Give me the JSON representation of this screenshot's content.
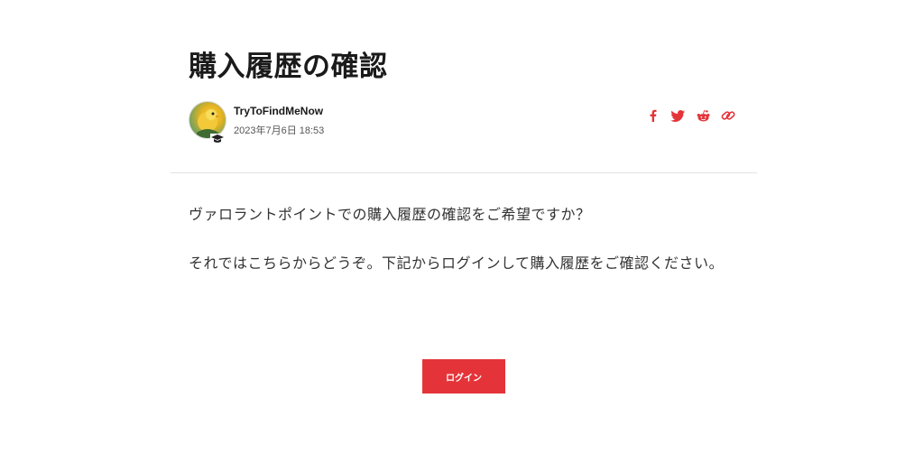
{
  "article": {
    "title": "購入履歴の確認",
    "author": {
      "name": "TryToFindMeNow",
      "date": "2023年7月6日 18:53"
    },
    "share": {
      "color": "#e4343a",
      "icons": [
        "facebook-icon",
        "twitter-icon",
        "reddit-icon",
        "link-icon"
      ]
    },
    "paragraphs": [
      "ヴァロラントポイントでの購入履歴の確認をご希望ですか？",
      "それではこちらからどうぞ。下記からログインして購入履歴をご確認ください。"
    ],
    "login_button": {
      "label": "ログイン",
      "color": "#e4343a"
    }
  }
}
